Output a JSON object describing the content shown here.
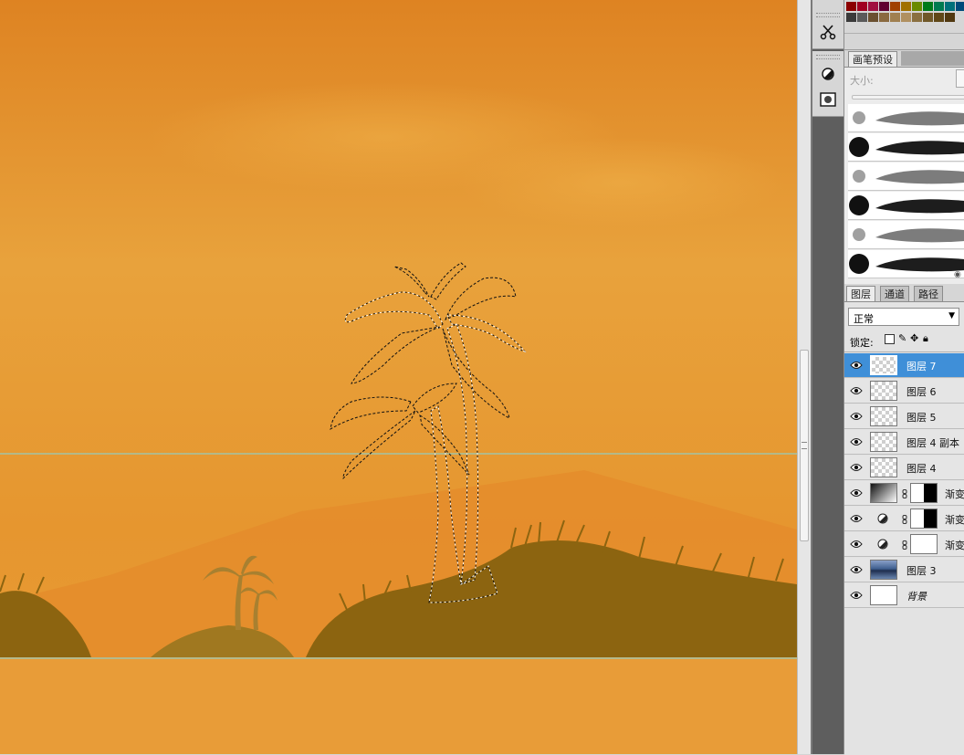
{
  "colors": {
    "sky_top": "#e08526",
    "sky_mid": "#e89a35",
    "ground": "#8c6410",
    "guide": "#7fd9e0",
    "selected_layer": "#3f8fd8"
  },
  "tools": {
    "icons": [
      "scissors-icon",
      "burn-icon",
      "quick-mask-icon"
    ]
  },
  "swatches": {
    "row1": [
      "#8b0000",
      "#a00020",
      "#a01040",
      "#600030",
      "#a04000",
      "#a07000",
      "#6a8a00",
      "#007a1a",
      "#007a50",
      "#00707a",
      "#004a7a",
      "#1a2a7a",
      "#3a1a7a"
    ],
    "row2": [
      "#3a3a3a",
      "#5a5a5a",
      "#6a5030",
      "#8a6a40",
      "#a08050",
      "#b09060",
      "#8a7040",
      "#705828",
      "#604818",
      "#503810"
    ]
  },
  "brushes_panel": {
    "tab_label": "画笔预设",
    "size_label": "大小:"
  },
  "layers_panel": {
    "tabs": [
      "图层",
      "通道",
      "路径"
    ],
    "blend_mode": "正常",
    "lock_label": "锁定:",
    "layers": [
      {
        "name": "图层 7",
        "selected": true,
        "thumb": "checker"
      },
      {
        "name": "图层 6",
        "selected": false,
        "thumb": "checker"
      },
      {
        "name": "图层 5",
        "selected": false,
        "thumb": "checker"
      },
      {
        "name": "图层 4 副本",
        "selected": false,
        "thumb": "checker"
      },
      {
        "name": "图层 4",
        "selected": false,
        "thumb": "checker"
      },
      {
        "name": "渐变",
        "selected": false,
        "thumb": "gradient-mask"
      },
      {
        "name": "渐变",
        "selected": false,
        "thumb": "adjust-mask"
      },
      {
        "name": "渐变",
        "selected": false,
        "thumb": "adjust-white"
      },
      {
        "name": "图层 3",
        "selected": false,
        "thumb": "photo"
      },
      {
        "name": "背景",
        "selected": false,
        "thumb": "white"
      }
    ]
  }
}
